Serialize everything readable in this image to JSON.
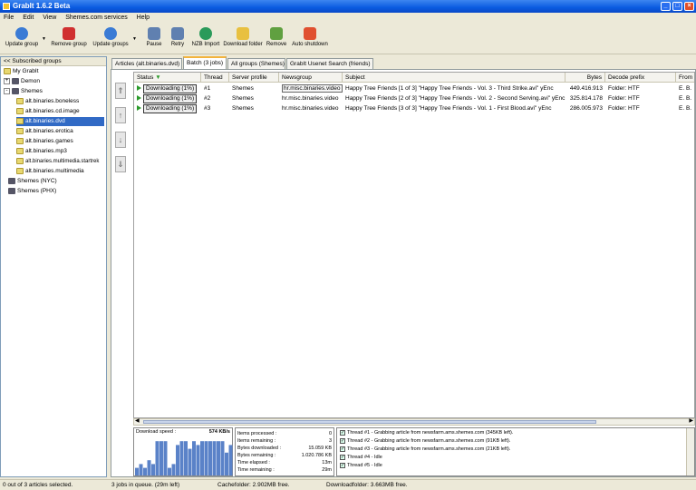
{
  "window": {
    "title": "GrabIt 1.6.2 Beta",
    "min": "_",
    "max": "□",
    "close": "×"
  },
  "menu": [
    "File",
    "Edit",
    "View",
    "Shemes.com services",
    "Help"
  ],
  "toolbar": [
    {
      "label": "Update group",
      "icon": "update-group-icon",
      "color": "#3a7bd5"
    },
    {
      "label": "Remove group",
      "icon": "remove-group-icon",
      "color": "#d03030"
    },
    {
      "label": "Update groups",
      "icon": "update-groups-icon",
      "color": "#3a7bd5"
    },
    {
      "label": "Pause",
      "icon": "pause-icon",
      "color": "#6080b0"
    },
    {
      "label": "Retry",
      "icon": "retry-icon",
      "color": "#6080b0"
    },
    {
      "label": "NZB Import",
      "icon": "globe-icon",
      "color": "#2a9a5a"
    },
    {
      "label": "Download folder",
      "icon": "folder-icon",
      "color": "#e8c040"
    },
    {
      "label": "Remove",
      "icon": "trash-icon",
      "color": "#60a040"
    },
    {
      "label": "Auto shutdown",
      "icon": "shutdown-icon",
      "color": "#e05030"
    }
  ],
  "sidebar": {
    "header": "Subscribed groups",
    "collapse": "<<",
    "items": [
      {
        "label": "My GrabIt",
        "type": "root"
      },
      {
        "label": "Demon",
        "type": "server",
        "pm": "+"
      },
      {
        "label": "Shemes",
        "type": "server",
        "pm": "-"
      },
      {
        "label": "alt.binaries.boneless",
        "type": "group"
      },
      {
        "label": "alt.binaries.cd.image",
        "type": "group"
      },
      {
        "label": "alt.binaries.dvd",
        "type": "group",
        "selected": true
      },
      {
        "label": "alt.binaries.erotica",
        "type": "group"
      },
      {
        "label": "alt.binaries.games",
        "type": "group"
      },
      {
        "label": "alt.binaries.mp3",
        "type": "group"
      },
      {
        "label": "alt.binaries.multimedia.startrek",
        "type": "group"
      },
      {
        "label": "alt.binaries.multimedia",
        "type": "group"
      },
      {
        "label": "Shemes (NYC)",
        "type": "server"
      },
      {
        "label": "Shemes (PHX)",
        "type": "server"
      }
    ]
  },
  "tabs": [
    "Articles (alt.binaries.dvd)",
    "Batch (3 jobs)",
    "All groups (Shemes)",
    "GrabIt Usenet Search (friends)"
  ],
  "active_tab": 1,
  "columns": [
    "Status",
    "Thread",
    "Server profile",
    "Newsgroup",
    "Subject",
    "Bytes",
    "Decode prefix",
    "From"
  ],
  "jobs": [
    {
      "status": "Downloading (1%)",
      "thread": "#1",
      "server": "Shemes",
      "newsgroup": "hr.misc.binaries.video",
      "subject": "Happy Tree Friends [1 of 3] \"Happy Tree Friends - Vol. 3 - Third Strike.avi\" yEnc",
      "bytes": "449.416.913",
      "decode": "Folder: HTF",
      "from": "E. B."
    },
    {
      "status": "Downloading (1%)",
      "thread": "#2",
      "server": "Shemes",
      "newsgroup": "hr.misc.binaries.video",
      "subject": "Happy Tree Friends [2 of 3] \"Happy Tree Friends - Vol. 2 - Second Serving.avi\" yEnc",
      "bytes": "325.814.178",
      "decode": "Folder: HTF",
      "from": "E. B."
    },
    {
      "status": "Downloading (1%)",
      "thread": "#3",
      "server": "Shemes",
      "newsgroup": "hr.misc.binaries.video",
      "subject": "Happy Tree Friends [3 of 3] \"Happy Tree Friends - Vol. 1 - First Blood.avi\" yEnc",
      "bytes": "286.005.973",
      "decode": "Folder: HTF",
      "from": "E. B."
    }
  ],
  "speed": {
    "label": "Download speed :",
    "value": "574 KB/s",
    "history": [
      2,
      3,
      2,
      4,
      3,
      9,
      9,
      9,
      2,
      3,
      8,
      9,
      9,
      7,
      9,
      8,
      9,
      9,
      9,
      9,
      9,
      9,
      6,
      8
    ]
  },
  "info": [
    {
      "label": "Items processed :",
      "value": "0"
    },
    {
      "label": "Items remaining :",
      "value": "3"
    },
    {
      "label": "Bytes downloaded :",
      "value": "15.059 KB"
    },
    {
      "label": "Bytes remaining :",
      "value": "1.020.786 KB"
    },
    {
      "label": "Time elapsed :",
      "value": "13m"
    },
    {
      "label": "Time remaining :",
      "value": "29m"
    }
  ],
  "threads": [
    "Thread #1 - Grabbing article from newsfarm.ams.shemes.com (345KB left).",
    "Thread #2 - Grabbing article from newsfarm.ams.shemes.com (91KB left).",
    "Thread #3 - Grabbing article from newsfarm.ams.shemes.com (21KB left).",
    "Thread #4 - Idle",
    "Thread #5 - Idle"
  ],
  "status": {
    "selection": "0 out of 3 articles selected.",
    "queue": "3 jobs in queue. (29m left)",
    "cache": "Cachefolder: 2.902MB free.",
    "download": "Downloadfolder: 3.663MB free."
  }
}
